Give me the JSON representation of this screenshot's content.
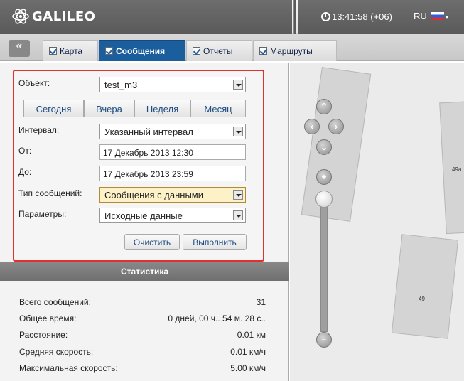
{
  "app": {
    "name": "GALILEO"
  },
  "header": {
    "clock": "13:41:58 (+06)",
    "language": "RU"
  },
  "tabs": [
    {
      "label": "Карта"
    },
    {
      "label": "Сообщения"
    },
    {
      "label": "Отчеты"
    },
    {
      "label": "Маршруты"
    }
  ],
  "form": {
    "object_label": "Объект:",
    "object_value": "test_m3",
    "quick_buttons": [
      "Сегодня",
      "Вчера",
      "Неделя",
      "Месяц"
    ],
    "interval_label": "Интервал:",
    "interval_value": "Указанный интервал",
    "from_label": "От:",
    "from_value": "17 Декабрь 2013 12:30",
    "to_label": "До:",
    "to_value": "17 Декабрь 2013 23:59",
    "msgtype_label": "Тип сообщений:",
    "msgtype_value": "Сообщения с данными",
    "params_label": "Параметры:",
    "params_value": "Исходные данные",
    "clear_label": "Очистить",
    "run_label": "Выполнить"
  },
  "stats": {
    "title": "Статистика",
    "rows": [
      {
        "label": "Всего сообщений:",
        "value": "31"
      },
      {
        "label": "Общее время:",
        "value": "0 дней, 00 ч.. 54 м. 28 с.."
      },
      {
        "label": "Расстояние:",
        "value": "0.01 км"
      },
      {
        "label": "Средняя скорость:",
        "value": "0.01 км/ч"
      },
      {
        "label": "Максимальная скорость:",
        "value": "5.00 км/ч"
      }
    ]
  },
  "map": {
    "building_labels": [
      "49a",
      "49"
    ]
  }
}
